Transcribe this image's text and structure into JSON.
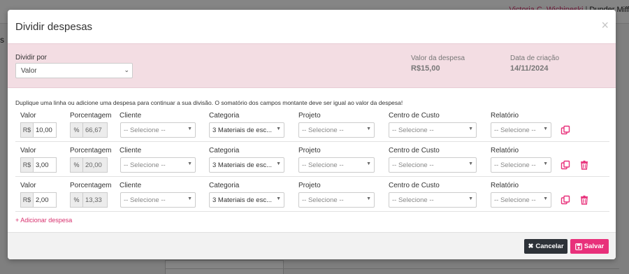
{
  "background": {
    "user_name": "Victoria C. Wichineski",
    "company": "Dunder Miff",
    "side_text": "s"
  },
  "modal": {
    "title": "Dividir despesas",
    "close_icon": "×",
    "divide_by": {
      "label": "Dividir por",
      "value": "Valor"
    },
    "expense_value": {
      "label": "Valor da despesa",
      "value": "R$15,00"
    },
    "creation_date": {
      "label": "Data de criação",
      "value": "14/11/2024"
    },
    "helper_text": "Duplique uma linha ou adicione uma despesa para continuar a sua divisão. O somatório dos campos montante deve ser igual ao valor da despesa!",
    "columns": {
      "valor": "Valor",
      "porcentagem": "Porcentagem",
      "cliente": "Cliente",
      "categoria": "Categoria",
      "projeto": "Projeto",
      "centro": "Centro de Custo",
      "relatorio": "Relatório"
    },
    "currency_prefix": "R$",
    "percent_prefix": "%",
    "rows": [
      {
        "valor": "10,00",
        "porcentagem": "66,67",
        "cliente": "-- Selecione --",
        "categoria": "3 Materiais de esc...",
        "projeto": "-- Selecione --",
        "centro": "-- Selecione --",
        "relatorio": "-- Selecione --"
      },
      {
        "valor": "3,00",
        "porcentagem": "20,00",
        "cliente": "-- Selecione --",
        "categoria": "3 Materiais de esc...",
        "projeto": "-- Selecione --",
        "centro": "-- Selecione --",
        "relatorio": "-- Selecione --"
      },
      {
        "valor": "2,00",
        "porcentagem": "13,33",
        "cliente": "-- Selecione --",
        "categoria": "3 Materiais de esc...",
        "projeto": "-- Selecione --",
        "centro": "-- Selecione --",
        "relatorio": "-- Selecione --"
      }
    ],
    "add_expense": "+ Adicionar despesa",
    "cancel_label": "Cancelar",
    "save_label": "Salvar"
  },
  "colors": {
    "accent": "#e8307a",
    "band": "#f3dde3",
    "dark_button": "#2d3238"
  },
  "icons": [
    "close-icon",
    "chevron-down-icon",
    "copy-icon",
    "trash-icon",
    "times-icon",
    "floppy-icon"
  ]
}
